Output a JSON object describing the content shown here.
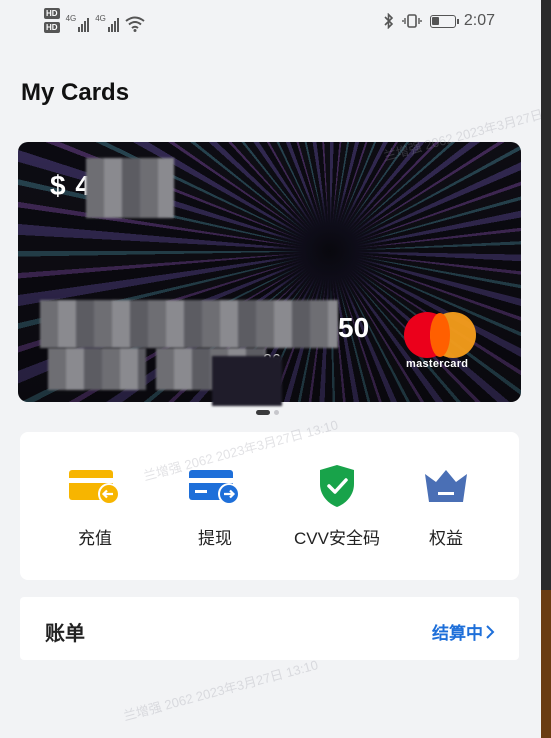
{
  "status_bar": {
    "hd1": "HD",
    "hd2": "HD",
    "net1": "4G",
    "net2": "4G",
    "time": "2:07",
    "battery_level": 0.35
  },
  "page": {
    "title": "My Cards"
  },
  "card": {
    "balance_prefix": "$ 4",
    "number_suffix": "50",
    "expiry_suffix": "26",
    "brand_text": "mastercard",
    "page_indicator": {
      "total": 2,
      "active": 1
    }
  },
  "actions": [
    {
      "label": "充值",
      "icon": "wallet-recharge-icon"
    },
    {
      "label": "提现",
      "icon": "card-withdraw-icon"
    },
    {
      "label": "CVV安全码",
      "icon": "shield-check-icon"
    },
    {
      "label": "权益",
      "icon": "crown-icon"
    }
  ],
  "bill": {
    "title": "账单",
    "status": "结算中"
  },
  "watermark": "兰增强 2062 2023年3月27日 13:10",
  "colors": {
    "background": "#f2f3f5",
    "accent_blue": "#1e6fd9",
    "recharge_yellow": "#f7b500",
    "shield_green": "#18a34a",
    "crown_blue": "#4a6fb5"
  }
}
